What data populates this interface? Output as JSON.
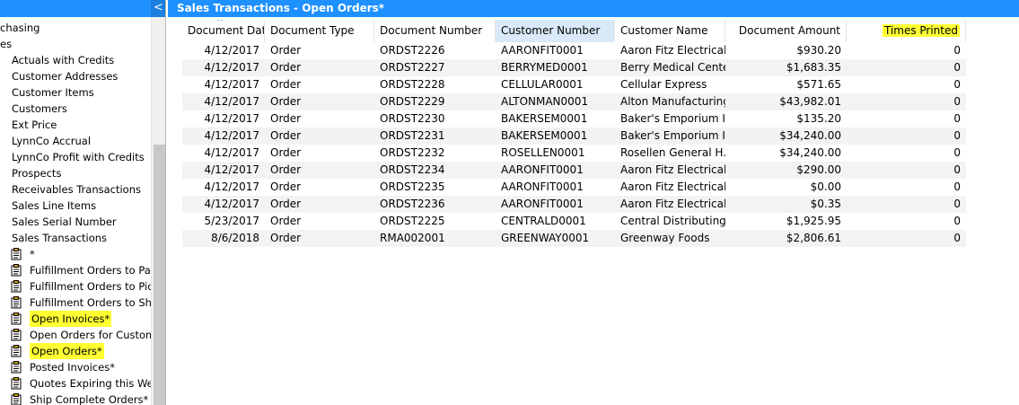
{
  "sidebar": {
    "collapse_glyph": "<",
    "items": [
      {
        "label": "chasing",
        "kind": "cut"
      },
      {
        "label": "es",
        "kind": "cut"
      },
      {
        "label": "Actuals with Credits",
        "kind": "plain"
      },
      {
        "label": "Customer Addresses",
        "kind": "plain"
      },
      {
        "label": "Customer Items",
        "kind": "plain"
      },
      {
        "label": "Customers",
        "kind": "plain"
      },
      {
        "label": "Ext Price",
        "kind": "plain"
      },
      {
        "label": "LynnCo Accrual",
        "kind": "plain"
      },
      {
        "label": "LynnCo Profit with Credits",
        "kind": "plain"
      },
      {
        "label": "Prospects",
        "kind": "plain"
      },
      {
        "label": "Receivables Transactions",
        "kind": "plain"
      },
      {
        "label": "Sales Line Items",
        "kind": "plain"
      },
      {
        "label": "Sales Serial Number",
        "kind": "plain"
      },
      {
        "label": "Sales Transactions",
        "kind": "plain"
      },
      {
        "label": "*",
        "kind": "icon"
      },
      {
        "label": "Fulfillment Orders to Pac",
        "kind": "icon"
      },
      {
        "label": "Fulfillment Orders to Pick",
        "kind": "icon"
      },
      {
        "label": "Fulfillment Orders to Ship",
        "kind": "icon"
      },
      {
        "label": "Open Invoices*",
        "kind": "icon",
        "highlight": true
      },
      {
        "label": "Open Orders for Custome",
        "kind": "icon"
      },
      {
        "label": "Open Orders*",
        "kind": "icon",
        "highlight": true
      },
      {
        "label": "Posted Invoices*",
        "kind": "icon"
      },
      {
        "label": "Quotes Expiring this Wee",
        "kind": "icon"
      },
      {
        "label": "Ship Complete Orders*",
        "kind": "icon"
      }
    ]
  },
  "main": {
    "title": "Sales Transactions - Open Orders*",
    "columns": [
      "Document Date",
      "Document Type",
      "Document Number",
      "Customer Number",
      "Customer Name",
      "Document Amount",
      "Times Printed"
    ],
    "rows": [
      [
        "4/12/2017",
        "Order",
        "ORDST2226",
        "AARONFIT0001",
        "Aaron Fitz Electrical",
        "$930.20",
        "0"
      ],
      [
        "4/12/2017",
        "Order",
        "ORDST2227",
        "BERRYMED0001",
        "Berry Medical Center",
        "$1,683.35",
        "0"
      ],
      [
        "4/12/2017",
        "Order",
        "ORDST2228",
        "CELLULAR0001",
        "Cellular Express",
        "$571.65",
        "0"
      ],
      [
        "4/12/2017",
        "Order",
        "ORDST2229",
        "ALTONMAN0001",
        "Alton Manufacturing",
        "$43,982.01",
        "0"
      ],
      [
        "4/12/2017",
        "Order",
        "ORDST2230",
        "BAKERSEM0001",
        "Baker's Emporium I...",
        "$135.20",
        "0"
      ],
      [
        "4/12/2017",
        "Order",
        "ORDST2231",
        "BAKERSEM0001",
        "Baker's Emporium I...",
        "$34,240.00",
        "0"
      ],
      [
        "4/12/2017",
        "Order",
        "ORDST2232",
        "ROSELLEN0001",
        "Rosellen General H...",
        "$34,240.00",
        "0"
      ],
      [
        "4/12/2017",
        "Order",
        "ORDST2234",
        "AARONFIT0001",
        "Aaron Fitz Electrical",
        "$290.00",
        "0"
      ],
      [
        "4/12/2017",
        "Order",
        "ORDST2235",
        "AARONFIT0001",
        "Aaron Fitz Electrical",
        "$0.00",
        "0"
      ],
      [
        "4/12/2017",
        "Order",
        "ORDST2236",
        "AARONFIT0001",
        "Aaron Fitz Electrical",
        "$0.35",
        "0"
      ],
      [
        "5/23/2017",
        "Order",
        "ORDST2225",
        "CENTRALD0001",
        "Central Distributing",
        "$1,925.95",
        "0"
      ],
      [
        "8/6/2018",
        "Order",
        "RMA002001",
        "GREENWAY0001",
        "Greenway Foods",
        "$2,806.61",
        "0"
      ]
    ]
  },
  "colors": {
    "header_blue": "#1e90ff",
    "highlight_yellow": "#ffff33",
    "selected_column": "#d9e9f9"
  },
  "icons": {
    "list_icon": "clipboard-icon"
  }
}
